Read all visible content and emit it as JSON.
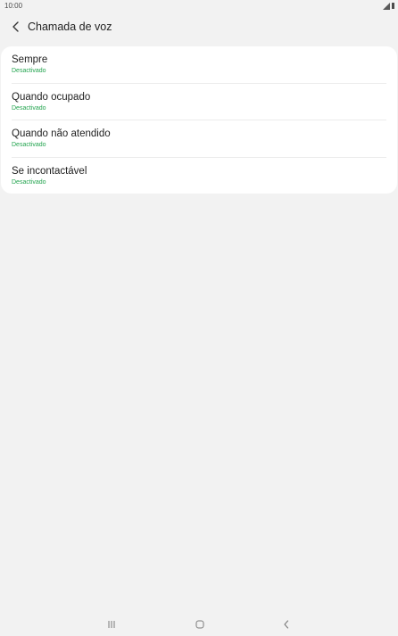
{
  "status_bar": {
    "time": "10:00",
    "icons": [
      "signal-icon",
      "battery-icon"
    ]
  },
  "header": {
    "back_icon": "back-arrow-icon",
    "title": "Chamada de voz"
  },
  "forwarding_options": [
    {
      "title": "Sempre",
      "status": "Desactivado"
    },
    {
      "title": "Quando ocupado",
      "status": "Desactivado"
    },
    {
      "title": "Quando não atendido",
      "status": "Desactivado"
    },
    {
      "title": "Se incontactável",
      "status": "Desactivado"
    }
  ],
  "navigation_bar": {
    "buttons": [
      "recents-icon",
      "home-icon",
      "back-icon"
    ]
  },
  "colors": {
    "background": "#f2f2f2",
    "card": "#ffffff",
    "status_text": "#23a44f",
    "primary_text": "#1f1f1f"
  }
}
